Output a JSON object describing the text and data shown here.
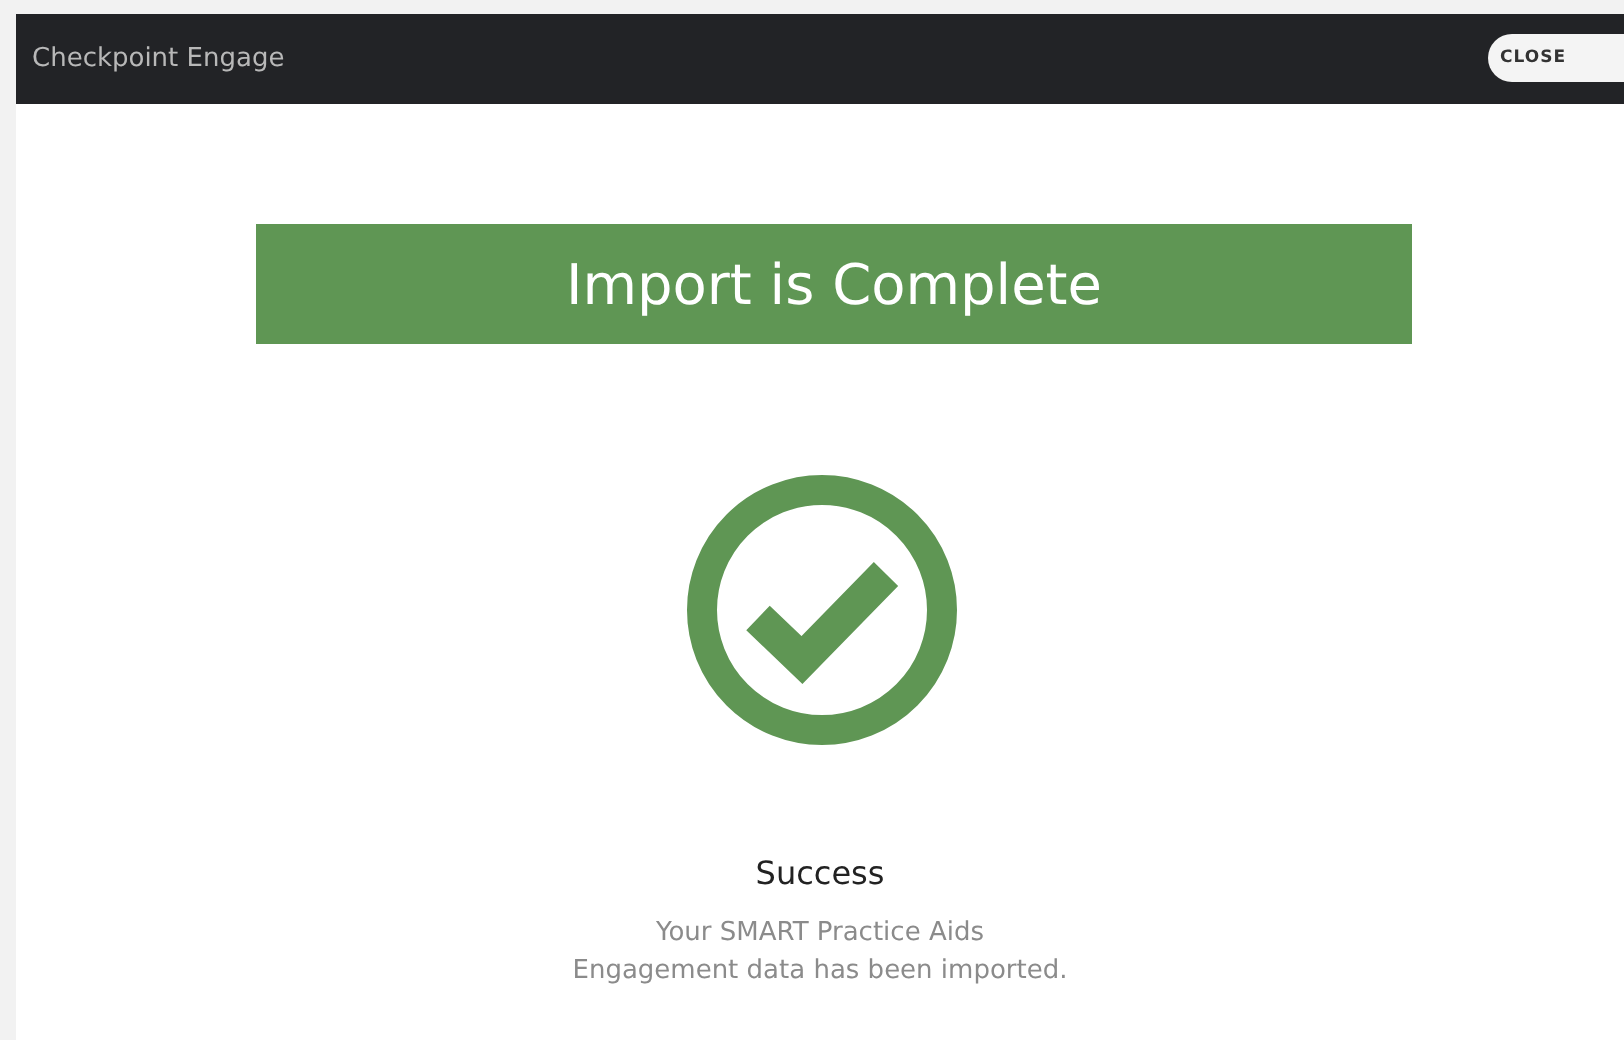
{
  "window": {
    "title": "Checkpoint Engage",
    "close_button": "CLOSE"
  },
  "banner": {
    "title": "Import is Complete"
  },
  "result": {
    "status": "Success",
    "message": "Your SMART Practice Aids\nEngagement data has been imported."
  }
}
